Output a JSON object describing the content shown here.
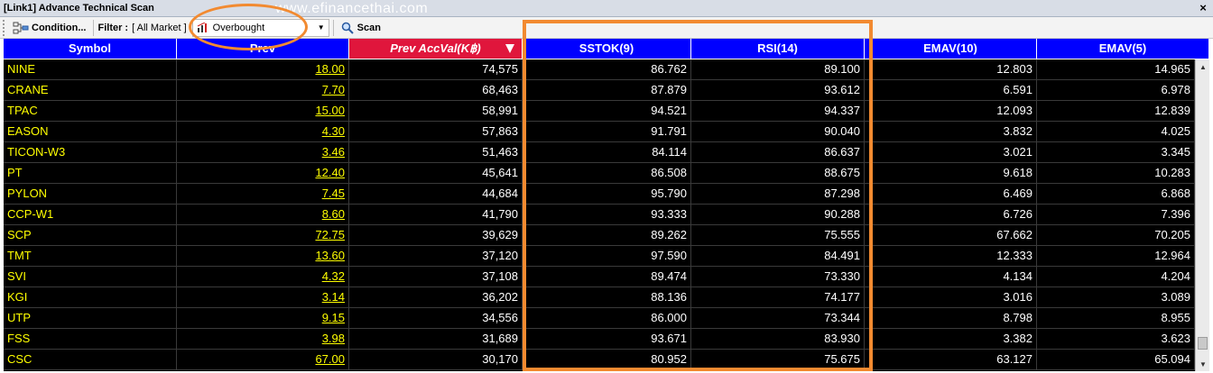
{
  "window": {
    "title": "[Link1] Advance Technical Scan",
    "watermark": "www.efinancethai.com",
    "close_glyph": "×"
  },
  "toolbar": {
    "condition_label": "Condition...",
    "filter_label": "Filter :",
    "filter_value": "[ All Market ]",
    "scan_type": "Overbought",
    "scan_label": "Scan"
  },
  "grid": {
    "columns": [
      "Symbol",
      "Prev",
      "Prev AccVal(K฿)",
      "SSTOK(9)",
      "RSI(14)",
      "EMAV(10)",
      "EMAV(5)"
    ],
    "sorted_column": "Prev AccVal(K฿)",
    "rows": [
      [
        "NINE",
        "18.00",
        "74,575",
        "86.762",
        "89.100",
        "12.803",
        "14.965"
      ],
      [
        "CRANE",
        "7.70",
        "68,463",
        "87.879",
        "93.612",
        "6.591",
        "6.978"
      ],
      [
        "TPAC",
        "15.00",
        "58,991",
        "94.521",
        "94.337",
        "12.093",
        "12.839"
      ],
      [
        "EASON",
        "4.30",
        "57,863",
        "91.791",
        "90.040",
        "3.832",
        "4.025"
      ],
      [
        "TICON-W3",
        "3.46",
        "51,463",
        "84.114",
        "86.637",
        "3.021",
        "3.345"
      ],
      [
        "PT",
        "12.40",
        "45,641",
        "86.508",
        "88.675",
        "9.618",
        "10.283"
      ],
      [
        "PYLON",
        "7.45",
        "44,684",
        "95.790",
        "87.298",
        "6.469",
        "6.868"
      ],
      [
        "CCP-W1",
        "8.60",
        "41,790",
        "93.333",
        "90.288",
        "6.726",
        "7.396"
      ],
      [
        "SCP",
        "72.75",
        "39,629",
        "89.262",
        "75.555",
        "67.662",
        "70.205"
      ],
      [
        "TMT",
        "13.60",
        "37,120",
        "97.590",
        "84.491",
        "12.333",
        "12.964"
      ],
      [
        "SVI",
        "4.32",
        "37,108",
        "89.474",
        "73.330",
        "4.134",
        "4.204"
      ],
      [
        "KGI",
        "3.14",
        "36,202",
        "88.136",
        "74.177",
        "3.016",
        "3.089"
      ],
      [
        "UTP",
        "9.15",
        "34,556",
        "86.000",
        "73.344",
        "8.798",
        "8.955"
      ],
      [
        "FSS",
        "3.98",
        "31,689",
        "93.671",
        "83.930",
        "3.382",
        "3.623"
      ],
      [
        "CSC",
        "67.00",
        "30,170",
        "80.952",
        "75.675",
        "63.127",
        "65.094"
      ]
    ]
  },
  "colors": {
    "header_bg": "#0000ff",
    "sorted_header_bg": "#e0163c",
    "grid_bg": "#000000",
    "symbol_text": "#ffff00",
    "annotation": "#f28a30"
  },
  "icons": {
    "condition": "condition-flow-icon",
    "overbought": "overbought-icon",
    "scan": "magnifier-icon",
    "sort": "sort-desc-icon"
  }
}
